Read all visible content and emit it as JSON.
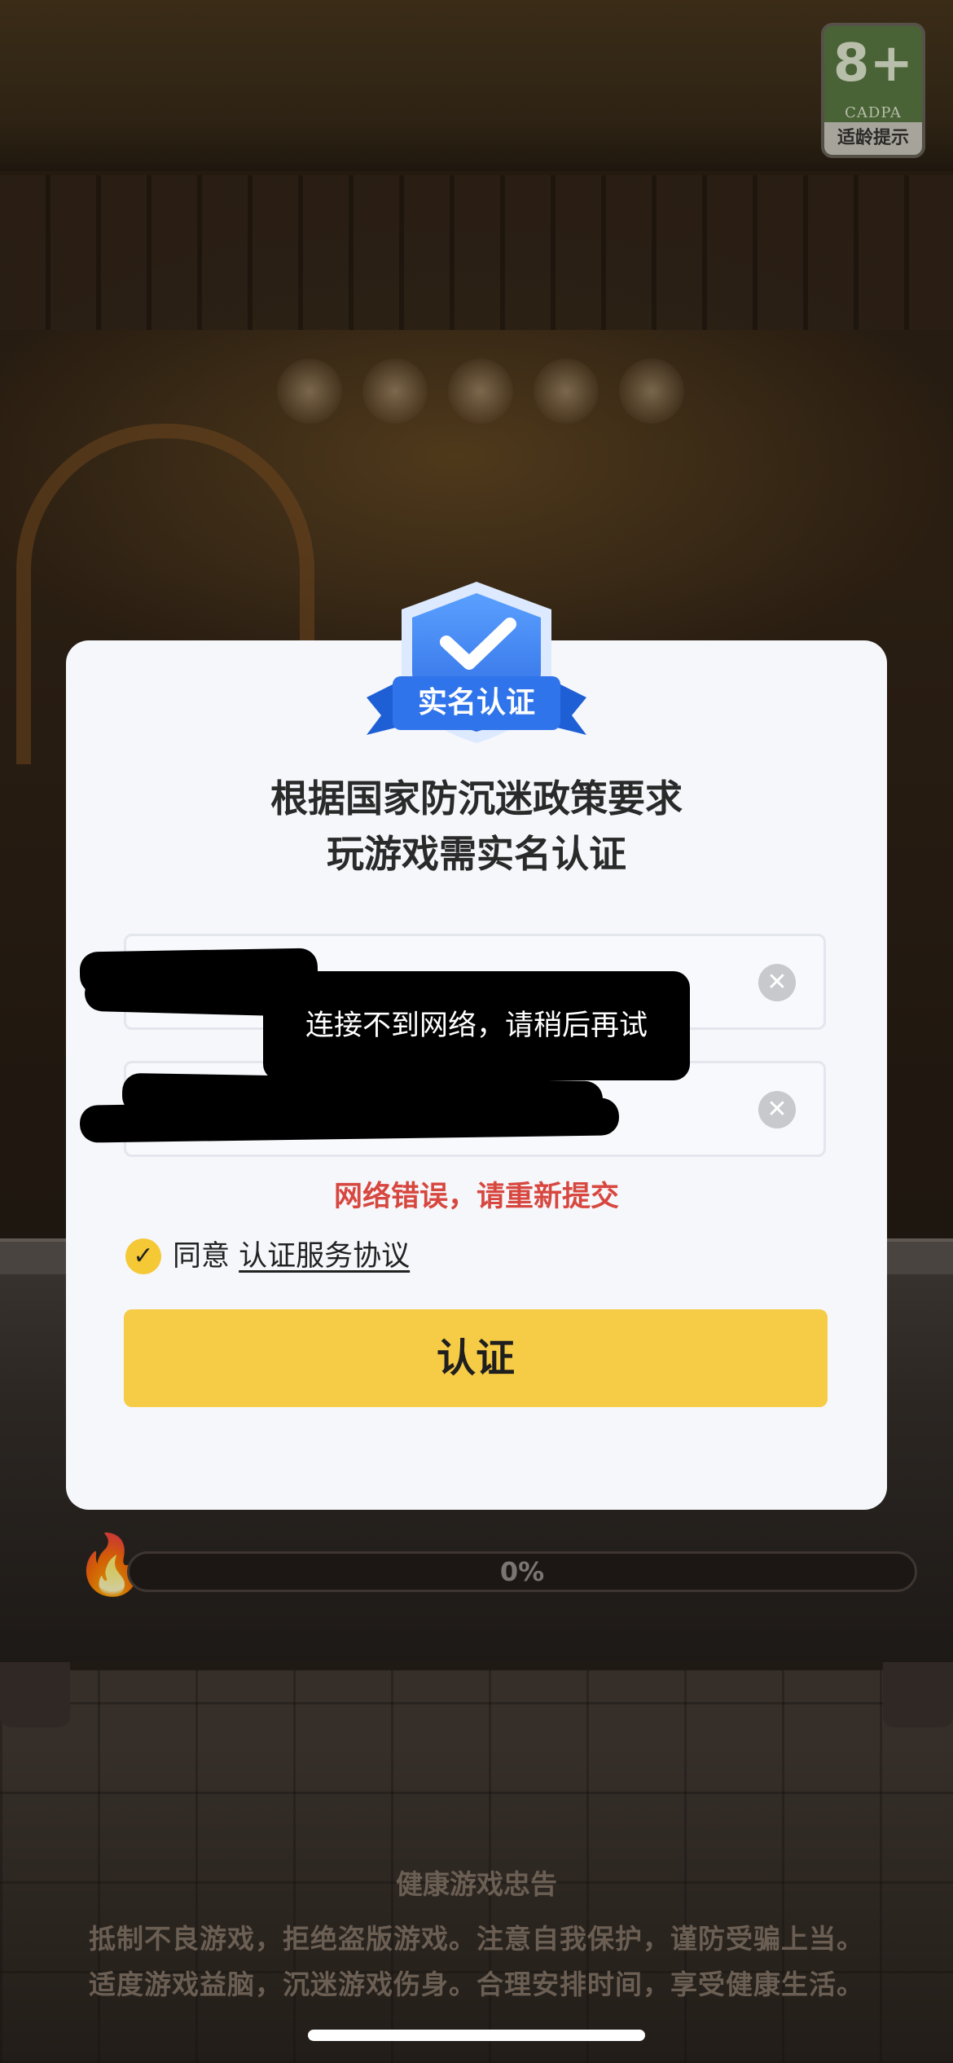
{
  "rating_badge": {
    "age": "8+",
    "org": "CADPA",
    "label": "适龄提示"
  },
  "dialog": {
    "badge_label": "实名认证",
    "title_line1": "根据国家防沉迷政策要求",
    "title_line2": "玩游戏需实名认证",
    "fields": [
      {
        "value": "",
        "clear_icon": "clear-icon"
      },
      {
        "value": "",
        "clear_icon": "clear-icon"
      }
    ],
    "error_text": "网络错误，请重新提交",
    "agree_prefix": "同意",
    "agree_link": "认证服务协议",
    "agree_checked": true,
    "submit_label": "认证"
  },
  "toast": {
    "text": "连接不到网络，请稍后再试"
  },
  "loading": {
    "percent_text": "0%",
    "progress": 0
  },
  "advisory": {
    "title": "健康游戏忠告",
    "line1": "抵制不良游戏，拒绝盗版游戏。注意自我保护，谨防受骗上当。",
    "line2": "适度游戏益脑，沉迷游戏伤身。合理安排时间，享受健康生活。"
  },
  "colors": {
    "accent": "#f6cb45",
    "error": "#d8473f",
    "shield_blue": "#2f74ea"
  }
}
